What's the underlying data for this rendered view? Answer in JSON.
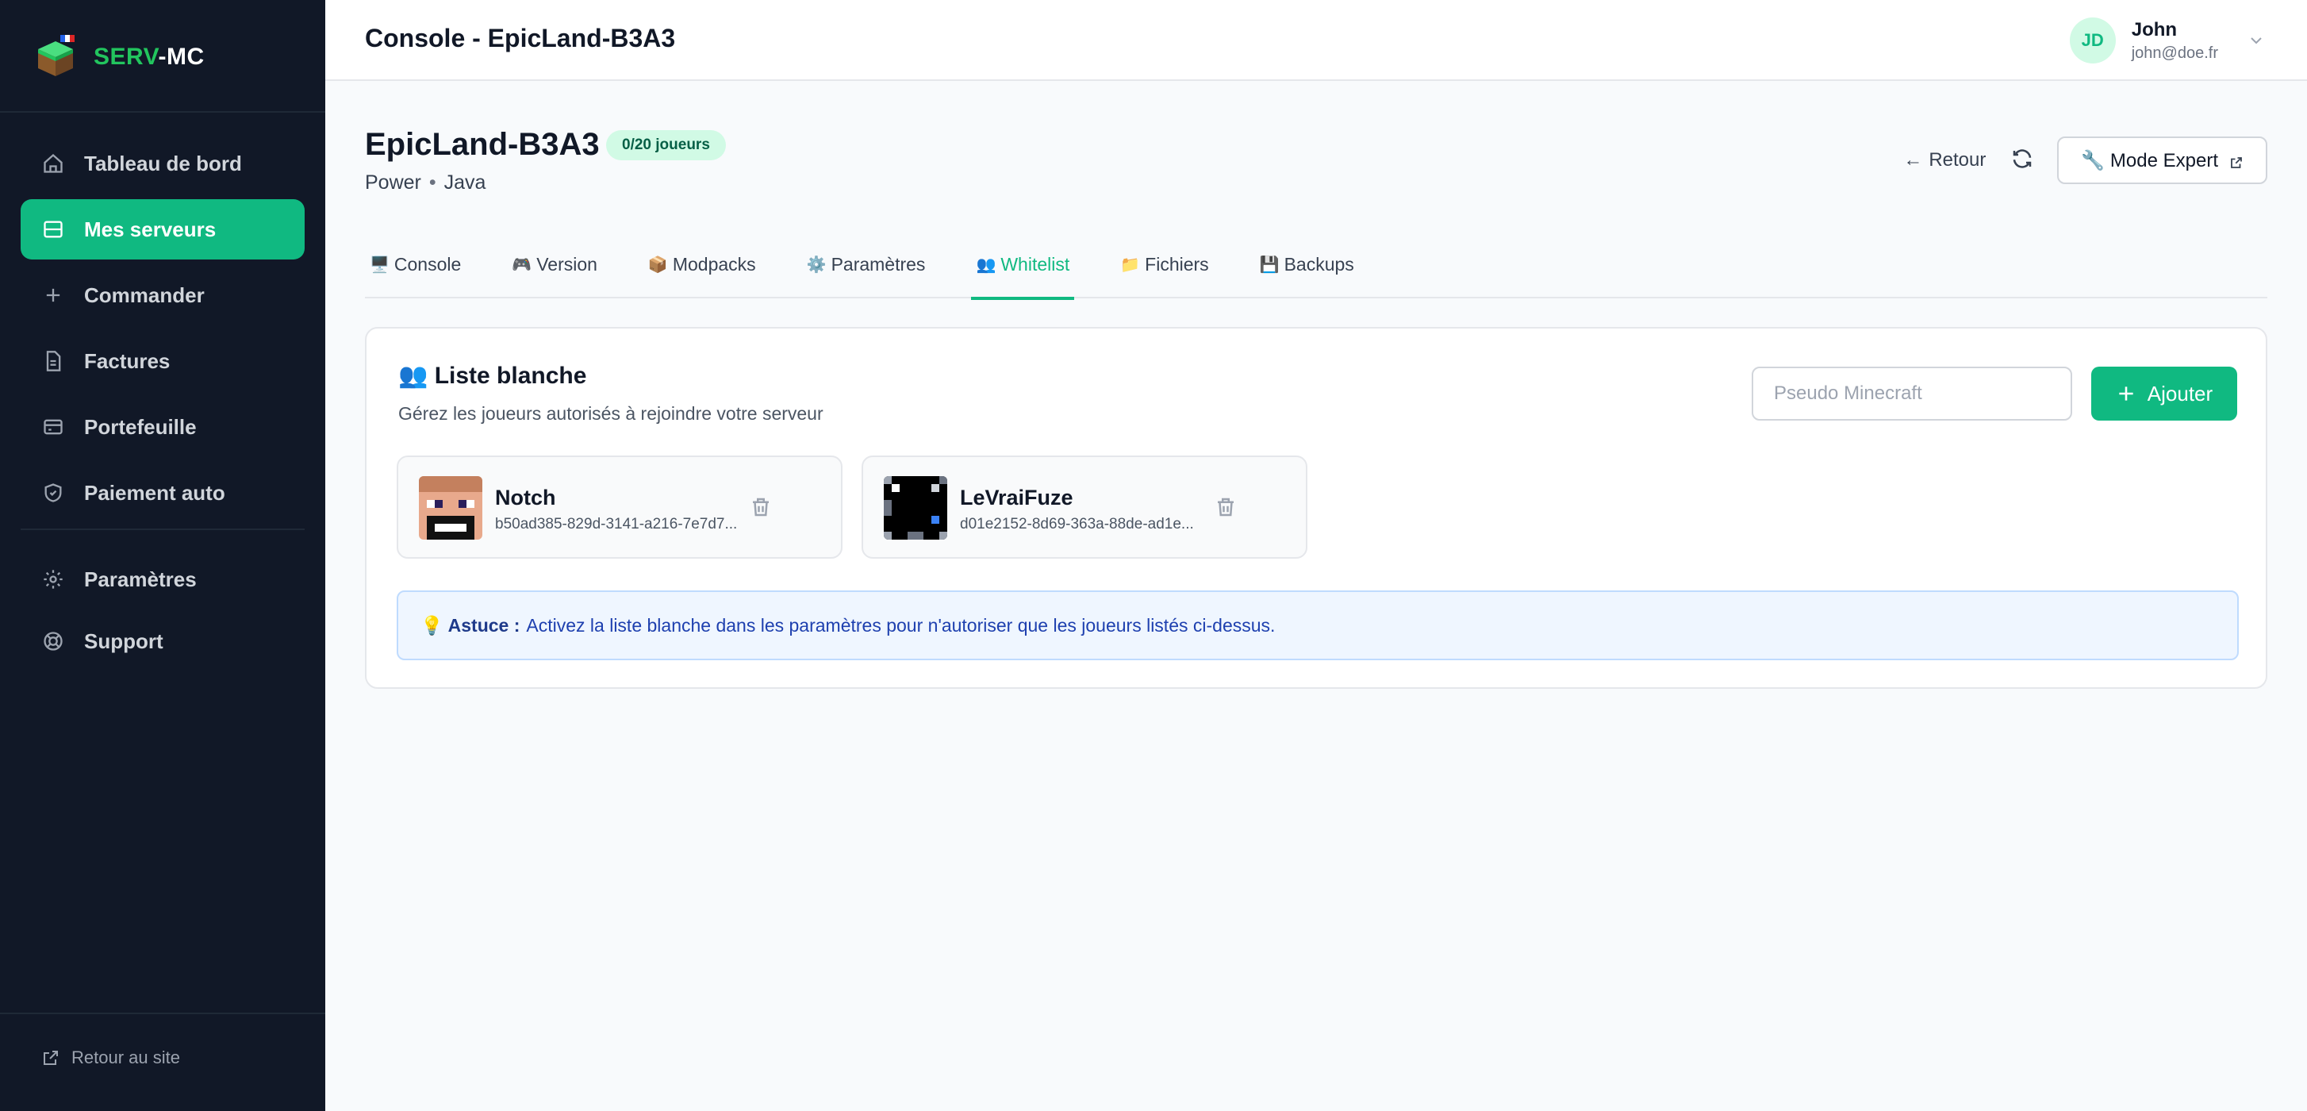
{
  "brand": {
    "part1": "SERV",
    "part2": "-MC"
  },
  "sidebar": {
    "items": [
      {
        "label": "Tableau de bord",
        "icon": "home-icon"
      },
      {
        "label": "Mes serveurs",
        "icon": "server-icon",
        "active": true
      },
      {
        "label": "Commander",
        "icon": "plus-icon"
      },
      {
        "label": "Factures",
        "icon": "file-icon"
      },
      {
        "label": "Portefeuille",
        "icon": "wallet-icon"
      },
      {
        "label": "Paiement auto",
        "icon": "shield-icon"
      }
    ],
    "secondary": [
      {
        "label": "Paramètres",
        "icon": "gear-icon"
      },
      {
        "label": "Support",
        "icon": "lifebuoy-icon"
      }
    ],
    "back_site": "Retour au site"
  },
  "header": {
    "title": "Console - EpicLand-B3A3",
    "user": {
      "initials": "JD",
      "name": "John",
      "email": "john@doe.fr"
    }
  },
  "server": {
    "name": "EpicLand-B3A3",
    "players_badge": "0/20 joueurs",
    "plan": "Power",
    "separator": "•",
    "edition": "Java"
  },
  "actions": {
    "back": "Retour",
    "back_arrow": "←",
    "expert": "🔧 Mode Expert"
  },
  "tabs": [
    {
      "emoji": "🖥️",
      "label": "Console"
    },
    {
      "emoji": "🎮",
      "label": "Version"
    },
    {
      "emoji": "📦",
      "label": "Modpacks"
    },
    {
      "emoji": "⚙️",
      "label": "Paramètres"
    },
    {
      "emoji": "👥",
      "label": "Whitelist",
      "active": true
    },
    {
      "emoji": "📁",
      "label": "Fichiers"
    },
    {
      "emoji": "💾",
      "label": "Backups"
    }
  ],
  "whitelist": {
    "title": "👥 Liste blanche",
    "description": "Gérez les joueurs autorisés à rejoindre votre serveur",
    "input_placeholder": "Pseudo Minecraft",
    "add_label": "Ajouter",
    "players": [
      {
        "name": "Notch",
        "uuid": "b50ad385-829d-3141-a216-7e7d7..."
      },
      {
        "name": "LeVraiFuze",
        "uuid": "d01e2152-8d69-363a-88de-ad1e..."
      }
    ],
    "tip_emoji": "💡",
    "tip_label": "Astuce :",
    "tip_text": "Activez la liste blanche dans les paramètres pour n'autoriser que les joueurs listés ci-dessus."
  },
  "colors": {
    "accent": "#10b981",
    "sidebar": "#111827",
    "tip_bg": "#eff6ff"
  }
}
